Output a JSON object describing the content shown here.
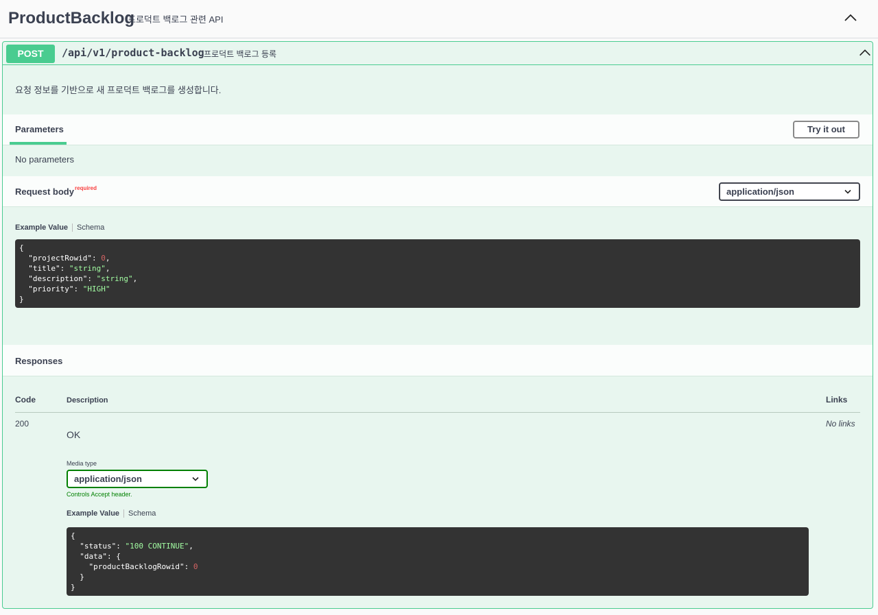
{
  "tag": {
    "name": "ProductBacklog",
    "description": "프로덕트 백로그 관련 API"
  },
  "operation": {
    "method": "POST",
    "path": "/api/v1/product-backlog",
    "summary": "프로덕트 백로그 등록",
    "description": "요청 정보를 기반으로 새 프로덕트 백로그를 생성합니다.",
    "colors": {
      "method": "#49cc90",
      "background": "#e8f6ef"
    }
  },
  "parameters": {
    "tab_label": "Parameters",
    "try_it_out": "Try it out",
    "empty_text": "No parameters"
  },
  "request_body": {
    "title": "Request body",
    "required_label": "required",
    "content_type": "application/json",
    "example_tab": "Example Value",
    "schema_tab": "Schema",
    "example": {
      "open": "{",
      "close": "}",
      "lines": [
        {
          "key": "\"projectRowid\"",
          "value": "0",
          "kind": "number",
          "comma": ","
        },
        {
          "key": "\"title\"",
          "value": "\"string\"",
          "kind": "string",
          "comma": ","
        },
        {
          "key": "\"description\"",
          "value": "\"string\"",
          "kind": "string",
          "comma": ","
        },
        {
          "key": "\"priority\"",
          "value": "\"HIGH\"",
          "kind": "string",
          "comma": ""
        }
      ]
    }
  },
  "responses": {
    "title": "Responses",
    "columns": {
      "code": "Code",
      "description": "Description",
      "links": "Links"
    },
    "items": [
      {
        "code": "200",
        "description": "OK",
        "links": "No links",
        "media_type_label": "Media type",
        "media_type": "application/json",
        "controls_text": "Controls Accept header.",
        "example_tab": "Example Value",
        "schema_tab": "Schema",
        "example_lines": [
          "{",
          "  \"status\": \"100 CONTINUE\",",
          "  \"data\": {",
          "    \"productBacklogRowid\": 0",
          "  }",
          "}"
        ]
      }
    ]
  }
}
